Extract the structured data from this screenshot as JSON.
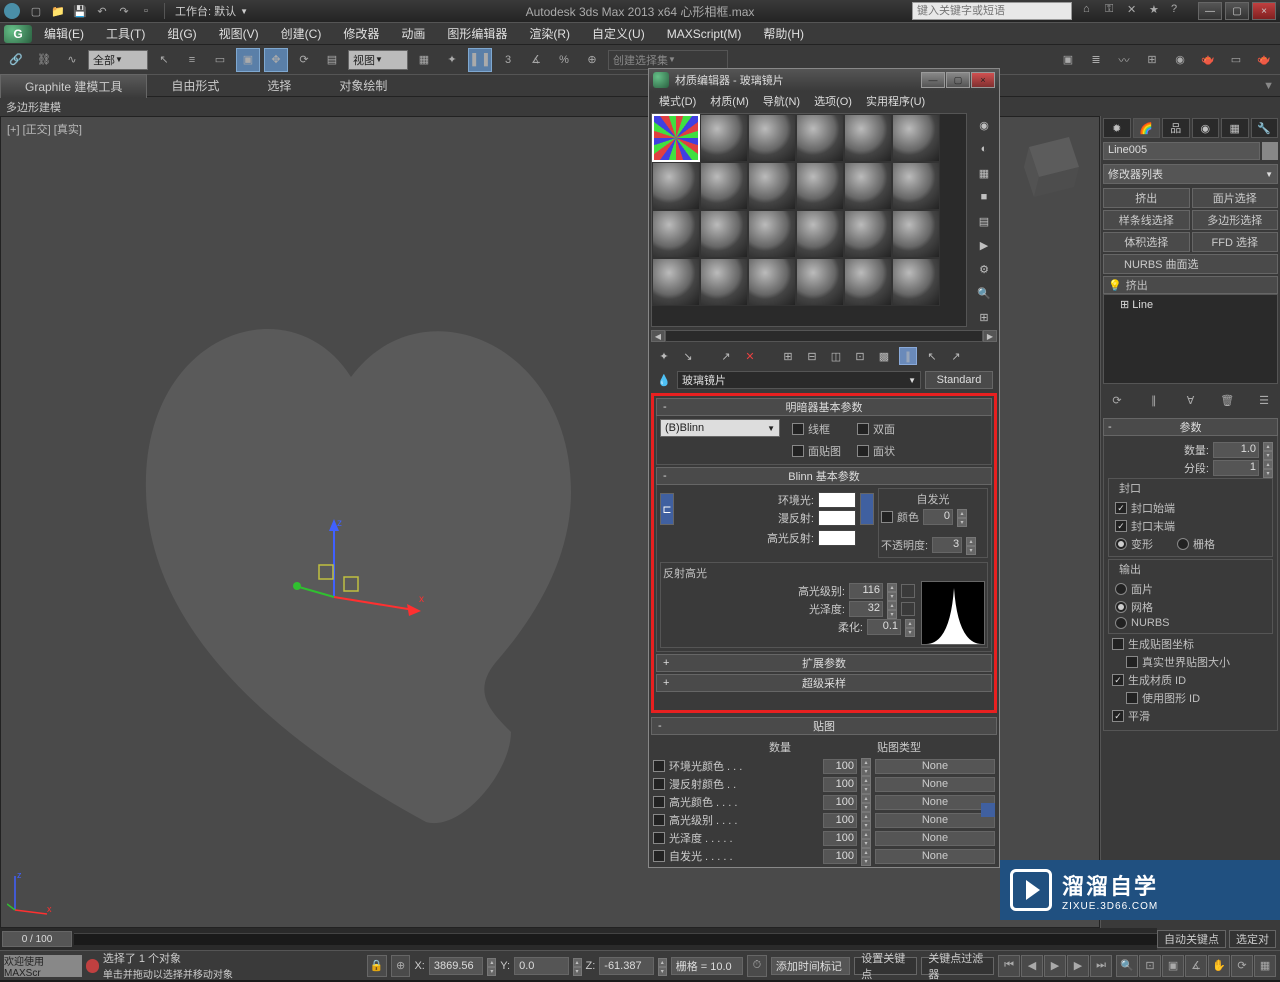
{
  "titlebar": {
    "workspace_label": "工作台: 默认",
    "title": "Autodesk 3ds Max  2013 x64     心形相框.max",
    "search_placeholder": "键入关键字或短语"
  },
  "menubar": {
    "items": [
      "编辑(E)",
      "工具(T)",
      "组(G)",
      "视图(V)",
      "创建(C)",
      "修改器",
      "动画",
      "图形编辑器",
      "渲染(R)",
      "自定义(U)",
      "MAXScript(M)",
      "帮助(H)"
    ]
  },
  "toolbar": {
    "filter": "全部",
    "view_dd": "视图",
    "createset_placeholder": "创建选择集"
  },
  "ribbon": {
    "tabs": [
      "Graphite 建模工具",
      "自由形式",
      "选择",
      "对象绘制"
    ],
    "sub": "多边形建模"
  },
  "viewport": {
    "label": "[+] [正交] [真实]"
  },
  "cmdpanel": {
    "obj_name": "Line005",
    "mod_list_label": "修改器列表",
    "buttons": [
      "挤出",
      "面片选择",
      "样条线选择",
      "多边形选择",
      "体积选择",
      "FFD 选择"
    ],
    "nurbs_label": "NURBS 曲面选",
    "stack": {
      "modifier": "挤出",
      "base": "Line"
    },
    "rollout_params": "参数",
    "amount_label": "数量:",
    "amount_val": "1.0",
    "segments_label": "分段:",
    "segments_val": "1",
    "capping_group": "封口",
    "cap_start": "封口始端",
    "cap_end": "封口末端",
    "morph": "变形",
    "grid": "栅格",
    "output_group": "输出",
    "patch": "面片",
    "mesh": "网格",
    "nurbs": "NURBS",
    "gen_map": "生成贴图坐标",
    "real_world": "真实世界贴图大小",
    "gen_matid": "生成材质 ID",
    "use_shapeid": "使用图形 ID",
    "smooth": "平滑"
  },
  "mateditor": {
    "title": "材质编辑器 - 玻璃镜片",
    "menu": [
      "模式(D)",
      "材质(M)",
      "导航(N)",
      "选项(O)",
      "实用程序(U)"
    ],
    "mat_name": "玻璃镜片",
    "mat_type": "Standard",
    "rollout_shader": "明暗器基本参数",
    "shader": "(B)Blinn",
    "wire": "线框",
    "twosided": "双面",
    "facemap": "面贴图",
    "faceted": "面状",
    "rollout_blinn": "Blinn 基本参数",
    "ambient": "环境光:",
    "diffuse": "漫反射:",
    "specular": "高光反射:",
    "self_illum_group": "自发光",
    "color": "颜色",
    "color_val": "0",
    "opacity": "不透明度:",
    "opacity_val": "3",
    "spec_group": "反射高光",
    "spec_level": "高光级别:",
    "spec_level_val": "116",
    "gloss": "光泽度:",
    "gloss_val": "32",
    "soften": "柔化:",
    "soften_val": "0.1",
    "rollout_ext": "扩展参数",
    "rollout_ss": "超级采样",
    "rollout_maps": "贴图",
    "maps_col_amount": "数量",
    "maps_col_type": "贴图类型",
    "maps": [
      {
        "label": "环境光颜色 . . .",
        "val": "100",
        "type": "None"
      },
      {
        "label": "漫反射颜色 . .",
        "val": "100",
        "type": "None"
      },
      {
        "label": "高光颜色 . . . .",
        "val": "100",
        "type": "None"
      },
      {
        "label": "高光级别 . . . .",
        "val": "100",
        "type": "None"
      },
      {
        "label": "光泽度 . . . . .",
        "val": "100",
        "type": "None"
      },
      {
        "label": "自发光 . . . . .",
        "val": "100",
        "type": "None"
      }
    ]
  },
  "statusbar": {
    "welcome": "欢迎使用  MAXScr",
    "selected": "选择了 1 个对象",
    "hint": "单击并拖动以选择并移动对象",
    "x": "3869.56",
    "y": "0.0",
    "z": "-61.387",
    "grid": "栅格 = 10.0",
    "addtime": "添加时间标记",
    "autokey": "自动关键点",
    "setkey": "设置关键点",
    "selset": "选定对",
    "keyfilter": "关键点过滤器"
  },
  "timeline": {
    "slider": "0 / 100"
  },
  "logo": {
    "big": "溜溜自学",
    "sm": "ZIXUE.3D66.COM"
  }
}
